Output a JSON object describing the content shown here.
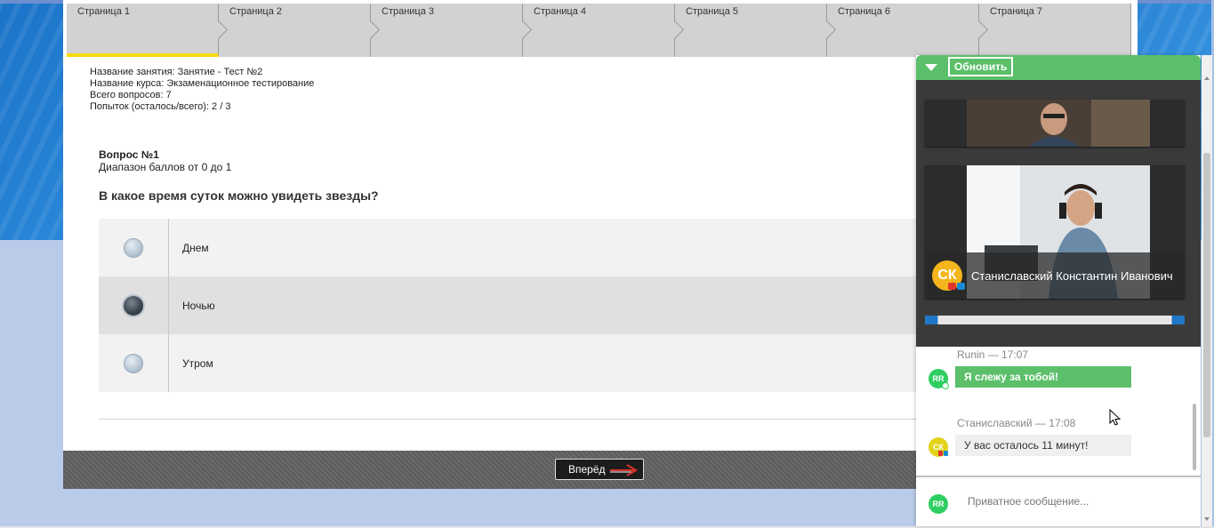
{
  "pager": {
    "pages": [
      "Страница 1",
      "Страница 2",
      "Страница 3",
      "Страница 4",
      "Страница 5",
      "Страница 6",
      "Страница 7"
    ],
    "active_index": 0,
    "active_color": "#f5d90a"
  },
  "info": {
    "lesson": "Название занятия: Занятие - Тест №2",
    "course": "Название курса: Экзаменационное тестирование",
    "total": "Всего вопросов: 7",
    "attempts": "Попыток (осталось/всего): 2 / 3"
  },
  "question": {
    "number": "Вопрос №1",
    "range": "Диапазон баллов от 0 до 1",
    "text": "В какое время суток можно увидеть звезды?",
    "answers": [
      {
        "label": "Днем",
        "selected": false
      },
      {
        "label": "Ночью",
        "selected": true
      },
      {
        "label": "Утром",
        "selected": false
      }
    ]
  },
  "footer": {
    "next_label": "Вперёд"
  },
  "panel": {
    "refresh_label": "Обновить",
    "header_color": "#5cbf6a",
    "presenter": {
      "initials": "СК",
      "name": "Станиславский Константин Иванович"
    },
    "messages": [
      {
        "author": "Runin",
        "time": "— 17:07",
        "initials": "RR",
        "text": "Я слежу за тобой!"
      },
      {
        "author": "Станиславский",
        "time": "— 17:08",
        "initials": "СК",
        "text": "У вас осталось 11 минут!"
      }
    ],
    "input": {
      "initials": "RR",
      "placeholder": "Приватное сообщение..."
    }
  }
}
